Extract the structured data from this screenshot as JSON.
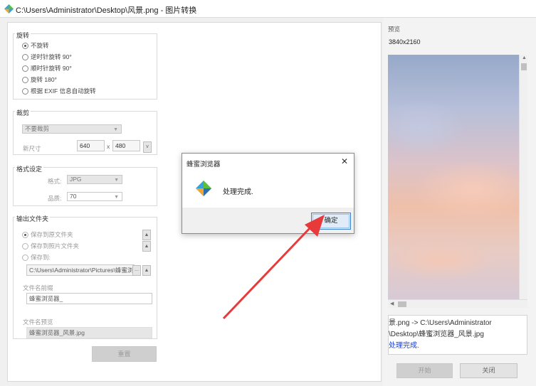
{
  "window": {
    "title": "C:\\Users\\Administrator\\Desktop\\风景.png - 图片转换"
  },
  "rotation": {
    "title": "旋转",
    "options": [
      "不旋转",
      "逆时针旋转 90°",
      "顺时针旋转 90°",
      "旋转 180°",
      "根据 EXIF 信息自动旋转"
    ],
    "selected_index": 0
  },
  "crop": {
    "title": "裁剪",
    "mode_value": "不要裁剪",
    "size_label": "新尺寸",
    "width_value": "640",
    "times": "x",
    "height_value": "480",
    "chevron": "v"
  },
  "format": {
    "title": "格式设定",
    "format_label": "格式:",
    "format_value": "JPG",
    "quality_label": "品质:",
    "quality_value": "70"
  },
  "output": {
    "title": "输出文件夹",
    "options": [
      "保存到原文件夹",
      "保存到照片文件夹",
      "保存到:"
    ],
    "selected_index": 0,
    "path_value": "C:\\Users\\Administrator\\Pictures\\蜂蜜浏",
    "browse_label": "...",
    "prefix_label": "文件名前缀",
    "prefix_value": "蜂蜜浏览器_",
    "filename_preview_label": "文件名预览",
    "filename_preview_value": "蜂蜜浏览器_风景.jpg",
    "reset_button": "重置"
  },
  "preview": {
    "title": "预览",
    "dimensions": "3840x2160"
  },
  "log": {
    "lines": [
      "景.png -> C:\\Users\\Administrator",
      "\\Desktop\\蜂蜜浏览器_风景.jpg"
    ],
    "status": "处理完成."
  },
  "actions": {
    "start_button": "开始",
    "close_button": "关闭"
  },
  "dialog": {
    "title": "蜂蜜浏览器",
    "message": "处理完成.",
    "ok_button": "确定",
    "close_glyph": "✕"
  },
  "colors": {
    "annotation_arrow": "#e83a3a",
    "log_status": "#1a3fd0",
    "ok_button_border": "#3c7fd0"
  }
}
